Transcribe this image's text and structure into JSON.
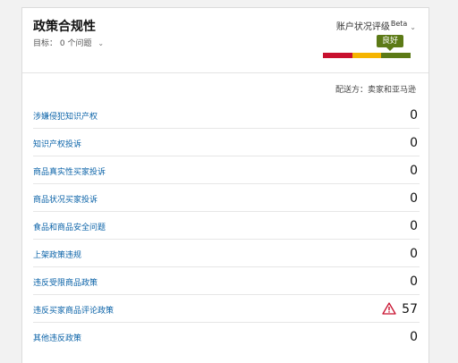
{
  "header": {
    "title": "政策合规性",
    "target_label": "目标：",
    "target_value": "0 个问题",
    "health_label": "账户状况评级",
    "beta": "Beta",
    "rating": "良好"
  },
  "colors": {
    "red": "#c8102e",
    "yellow": "#f5b400",
    "green": "#5c7a16",
    "link": "#0b63a8"
  },
  "ship_by": "配送方：卖家和亚马逊",
  "rows": [
    {
      "label": "涉嫌侵犯知识产权",
      "value": "0"
    },
    {
      "label": "知识产权投诉",
      "value": "0"
    },
    {
      "label": "商品真实性买家投诉",
      "value": "0"
    },
    {
      "label": "商品状况买家投诉",
      "value": "0"
    },
    {
      "label": "食品和商品安全问题",
      "value": "0"
    },
    {
      "label": "上架政策违规",
      "value": "0"
    },
    {
      "label": "违反受限商品政策",
      "value": "0"
    },
    {
      "label": "违反买家商品评论政策",
      "value": "57",
      "warning": true
    },
    {
      "label": "其他违反政策",
      "value": "0"
    }
  ]
}
